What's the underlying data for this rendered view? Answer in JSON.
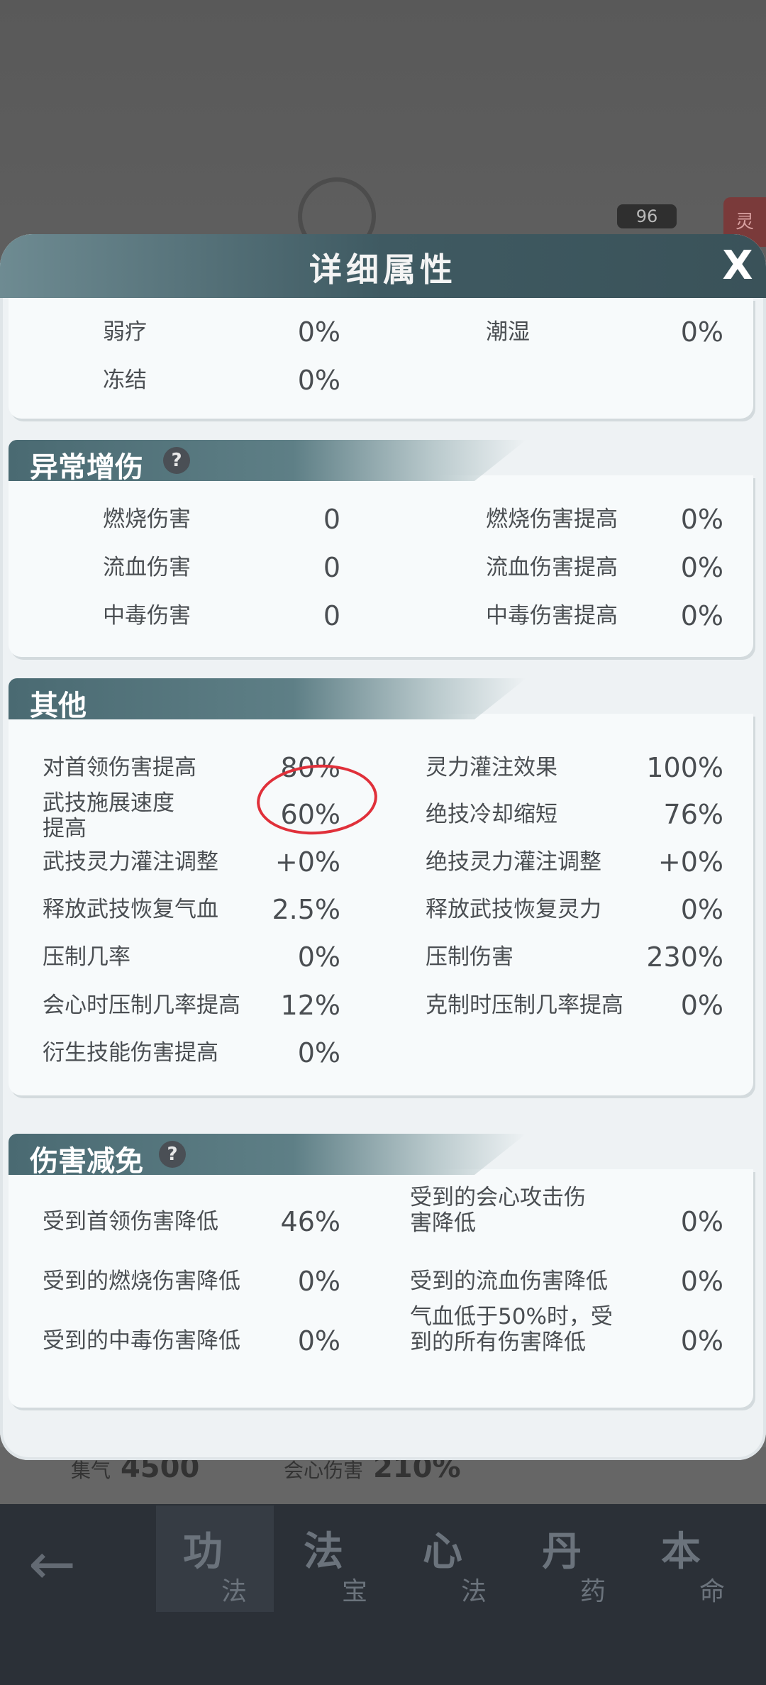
{
  "background": {
    "level": "96",
    "tag": "灵",
    "strip_left": {
      "icon": "集气",
      "value": "4500"
    },
    "strip_right": {
      "icon": "会心伤害",
      "value": "210%"
    }
  },
  "panel": {
    "title": "详细属性",
    "close": "X"
  },
  "top_rows": [
    {
      "label": "弱疗",
      "value": "0%"
    },
    {
      "label": "潮湿",
      "value": "0%"
    },
    {
      "label": "冻结",
      "value": "0%"
    }
  ],
  "abnormal": {
    "title": "异常增伤",
    "help": "?",
    "rows": [
      {
        "label": "燃烧伤害",
        "value": "0"
      },
      {
        "label": "燃烧伤害提高",
        "value": "0%"
      },
      {
        "label": "流血伤害",
        "value": "0"
      },
      {
        "label": "流血伤害提高",
        "value": "0%"
      },
      {
        "label": "中毒伤害",
        "value": "0"
      },
      {
        "label": "中毒伤害提高",
        "value": "0%"
      }
    ]
  },
  "other": {
    "title": "其他",
    "rows": [
      {
        "label": "对首领伤害提高",
        "value": "80%"
      },
      {
        "label": "灵力灌注效果",
        "value": "100%"
      },
      {
        "label": "武技施展速度提高",
        "label_l1": "武技施展速度",
        "label_l2": "提高",
        "value": "60%"
      },
      {
        "label": "绝技冷却缩短",
        "value": "76%"
      },
      {
        "label": "武技灵力灌注调整",
        "value": "+0%"
      },
      {
        "label": "绝技灵力灌注调整",
        "value": "+0%"
      },
      {
        "label": "释放武技恢复气血",
        "value": "2.5%"
      },
      {
        "label": "释放武技恢复灵力",
        "value": "0%"
      },
      {
        "label": "压制几率",
        "value": "0%"
      },
      {
        "label": "压制伤害",
        "value": "230%"
      },
      {
        "label": "会心时压制几率提高",
        "value": "12%"
      },
      {
        "label": "克制时压制几率提高",
        "value": "0%"
      },
      {
        "label": "衍生技能伤害提高",
        "value": "0%"
      }
    ]
  },
  "reduction": {
    "title": "伤害减免",
    "help": "?",
    "rows": [
      {
        "label": "受到首领伤害降低",
        "value": "46%"
      },
      {
        "label_l1": "受到的会心攻击伤",
        "label_l2": "害降低",
        "value": "0%"
      },
      {
        "label": "受到的燃烧伤害降低",
        "value": "0%"
      },
      {
        "label": "受到的流血伤害降低",
        "value": "0%"
      },
      {
        "label": "受到的中毒伤害降低",
        "value": "0%"
      },
      {
        "label_l1": "气血低于50%时，受",
        "label_l2": "到的所有伤害降低",
        "value": "0%"
      }
    ]
  },
  "nav": {
    "back": "←",
    "tabs": [
      {
        "big": "功",
        "small": "法"
      },
      {
        "big": "法",
        "small": "宝"
      },
      {
        "big": "心",
        "small": "法"
      },
      {
        "big": "丹",
        "small": "药"
      },
      {
        "big": "本",
        "small": "命"
      }
    ]
  },
  "colors": {
    "header": "#3f5a62",
    "panel_bg": "#eef2f4",
    "annotation": "#e0303a"
  }
}
